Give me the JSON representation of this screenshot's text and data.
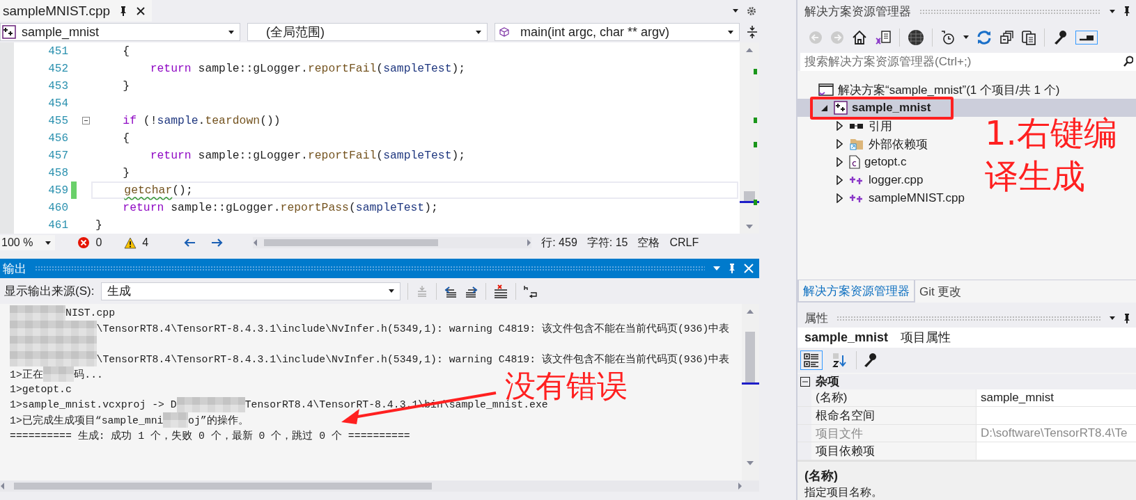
{
  "editor_tab": {
    "title": "sampleMNIST.cpp",
    "selected": true
  },
  "nav": {
    "project": "sample_mnist",
    "scope": "(全局范围)",
    "member": "main(int argc, char ** argv)"
  },
  "code": {
    "lines": [
      {
        "number": "451",
        "current": false,
        "changed": false,
        "fold": false,
        "tokens": [
          {
            "text": "    {",
            "kind": "plain"
          }
        ]
      },
      {
        "number": "452",
        "current": false,
        "changed": false,
        "fold": false,
        "tokens": [
          {
            "text": "        return",
            "kind": "keyword"
          },
          {
            "text": " sample::gLogger.",
            "kind": "plain"
          },
          {
            "text": "reportFail",
            "kind": "function"
          },
          {
            "text": "(",
            "kind": "plain"
          },
          {
            "text": "sampleTest",
            "kind": "variable"
          },
          {
            "text": ");",
            "kind": "plain"
          }
        ]
      },
      {
        "number": "453",
        "current": false,
        "changed": false,
        "fold": false,
        "tokens": [
          {
            "text": "    }",
            "kind": "plain"
          }
        ]
      },
      {
        "number": "454",
        "current": false,
        "changed": false,
        "fold": false
      },
      {
        "number": "455",
        "current": false,
        "changed": false,
        "fold": true,
        "tokens": [
          {
            "text": "    if",
            "kind": "keyword"
          },
          {
            "text": " (!",
            "kind": "plain"
          },
          {
            "text": "sample",
            "kind": "variable"
          },
          {
            "text": ".",
            "kind": "plain"
          },
          {
            "text": "teardown",
            "kind": "function"
          },
          {
            "text": "())",
            "kind": "plain"
          }
        ]
      },
      {
        "number": "456",
        "current": false,
        "changed": false,
        "fold": false,
        "tokens": [
          {
            "text": "    {",
            "kind": "plain"
          }
        ]
      },
      {
        "number": "457",
        "current": false,
        "changed": false,
        "fold": false,
        "tokens": [
          {
            "text": "        return",
            "kind": "keyword"
          },
          {
            "text": " sample::gLogger.",
            "kind": "plain"
          },
          {
            "text": "reportFail",
            "kind": "function"
          },
          {
            "text": "(",
            "kind": "plain"
          },
          {
            "text": "sampleTest",
            "kind": "variable"
          },
          {
            "text": ");",
            "kind": "plain"
          }
        ]
      },
      {
        "number": "458",
        "current": false,
        "changed": false,
        "fold": false,
        "tokens": [
          {
            "text": "    }",
            "kind": "plain"
          }
        ]
      },
      {
        "number": "459",
        "current": true,
        "changed": true,
        "fold": false,
        "tokens": [
          {
            "text": "    getchar",
            "kind": "function_warning"
          },
          {
            "text": "();",
            "kind": "plain"
          }
        ]
      },
      {
        "number": "460",
        "current": false,
        "changed": false,
        "fold": false,
        "tokens": [
          {
            "text": "    return",
            "kind": "keyword"
          },
          {
            "text": " sample::gLogger.",
            "kind": "plain"
          },
          {
            "text": "reportPass",
            "kind": "function"
          },
          {
            "text": "(",
            "kind": "plain"
          },
          {
            "text": "sampleTest",
            "kind": "variable"
          },
          {
            "text": ");",
            "kind": "plain"
          }
        ]
      },
      {
        "number": "461",
        "current": false,
        "changed": false,
        "fold": false,
        "tokens": [
          {
            "text": "}",
            "kind": "plain"
          }
        ]
      }
    ]
  },
  "status": {
    "zoom": "100 %",
    "errors": "0",
    "warnings": "4",
    "line": "行: 459",
    "column": "字符: 15",
    "indent": "空格",
    "eol": "CRLF"
  },
  "output": {
    "title": "输出",
    "source_label": "显示输出来源(S):",
    "source": "生成",
    "lines": [
      {
        "parts": [
          {
            "kind": "redacted"
          },
          {
            "kind": "text",
            "text": "NIST.cpp"
          }
        ]
      },
      {
        "parts": [
          {
            "kind": "redacted"
          },
          {
            "kind": "text",
            "text": "\\TensorRT8.4\\TensorRT-8.4.3.1\\include\\NvInfer.h(5349,1): warning C4819: 该文件包含不能在当前代码页(936)中表"
          }
        ]
      },
      {
        "parts": [
          {
            "kind": "redacted"
          }
        ]
      },
      {
        "parts": [
          {
            "kind": "redacted"
          },
          {
            "kind": "text",
            "text": "\\TensorRT8.4\\TensorRT-8.4.3.1\\include\\NvInfer.h(5349,1): warning C4819: 该文件包含不能在当前代码页(936)中表"
          }
        ]
      },
      {
        "parts": [
          {
            "kind": "text",
            "text": "1>正在"
          },
          {
            "kind": "redacted"
          },
          {
            "kind": "text",
            "text": "码..."
          }
        ]
      },
      {
        "parts": [
          {
            "kind": "text",
            "text": "1>getopt.c"
          }
        ]
      },
      {
        "parts": [
          {
            "kind": "text",
            "text": "1>sample_mnist.vcxproj -> D"
          },
          {
            "kind": "redacted"
          },
          {
            "kind": "text",
            "text": "TensorRT8.4\\TensorRT-8.4.3.1\\bin\\sample_mnist.exe"
          }
        ]
      },
      {
        "parts": [
          {
            "kind": "text",
            "text": "1>已完成生成项目“sample_mni"
          },
          {
            "kind": "redacted"
          },
          {
            "kind": "text",
            "text": "oj”的操作。"
          }
        ]
      },
      {
        "parts": [
          {
            "kind": "text",
            "text": "========== 生成: 成功 1 个，失败 0 个，最新 0 个，跳过 0 个 =========="
          }
        ]
      }
    ]
  },
  "solution_explorer": {
    "title": "解决方案资源管理器",
    "preview": {
      "selected": true
    },
    "search": {
      "placeholder": "搜索解决方案资源管理器(Ctrl+;)"
    },
    "tree": [
      {
        "label": "解决方案“sample_mnist”(1 个项目/共 1 个)",
        "kind": "solution",
        "selected": false,
        "children": [
          {
            "label": "sample_mnist",
            "kind": "project",
            "selected": true,
            "expanded": true,
            "children": [
              {
                "label": "引用",
                "kind": "references",
                "selected": false,
                "expanded": false
              },
              {
                "label": "外部依赖项",
                "kind": "dependencies",
                "selected": false,
                "expanded": false
              },
              {
                "label": "getopt.c",
                "kind": "c_file",
                "selected": false,
                "expanded": false
              },
              {
                "label": "logger.cpp",
                "kind": "cpp_file",
                "selected": false,
                "expanded": false
              },
              {
                "label": "sampleMNIST.cpp",
                "kind": "cpp_file",
                "selected": false,
                "expanded": false
              }
            ]
          }
        ]
      }
    ],
    "tabs": [
      {
        "label": "解决方案资源管理器",
        "selected": true
      },
      {
        "label": "Git 更改",
        "selected": false
      }
    ]
  },
  "properties": {
    "title": "属性",
    "object": "sample_mnist",
    "object_type": "项目属性",
    "views": [
      {
        "kind": "categorized",
        "selected": true
      },
      {
        "kind": "alphabetical",
        "selected": false
      }
    ],
    "category": {
      "label": "杂项",
      "expanded": true
    },
    "rows": [
      {
        "name": "(名称)",
        "value": "sample_mnist",
        "disabled": false
      },
      {
        "name": "根命名空间",
        "disabled": false
      },
      {
        "name": "项目文件",
        "value": "D:\\software\\TensorRT8.4\\Te",
        "disabled": true
      },
      {
        "name": "项目依赖项",
        "disabled": false
      }
    ],
    "description": {
      "title": "(名称)",
      "text": "指定项目名称。"
    }
  },
  "annotations": [
    {
      "kind": "note",
      "text": "1.右键编译生成"
    },
    {
      "kind": "arrow_note",
      "text": "没有错误"
    }
  ]
}
